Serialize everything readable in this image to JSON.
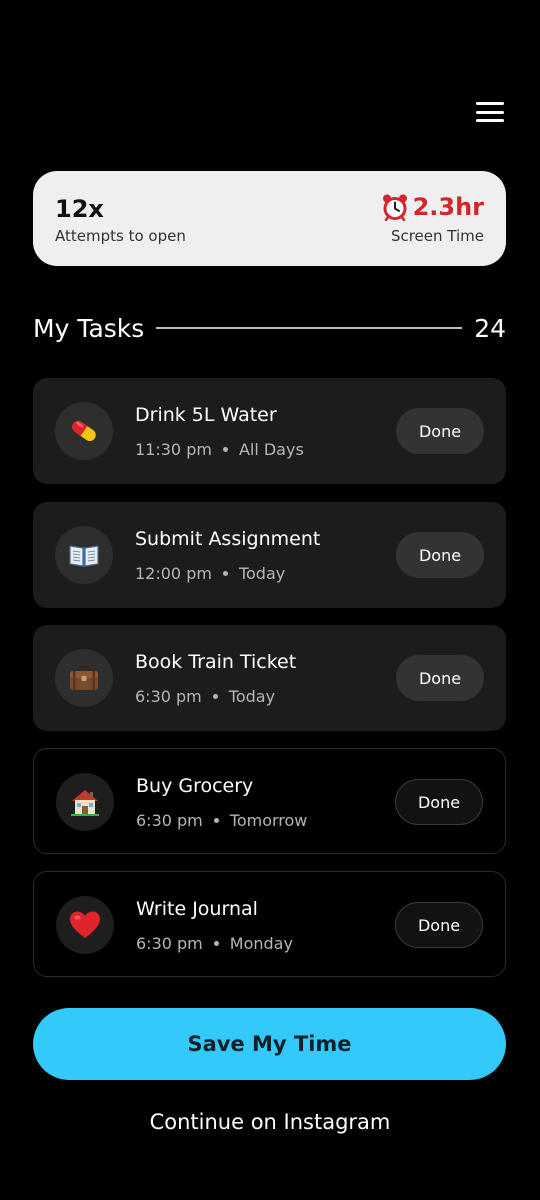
{
  "header": {
    "menu_icon": "hamburger-menu-icon"
  },
  "stats": {
    "attempts_value": "12x",
    "attempts_label": "Attempts to open",
    "screen_time_value": "2.3hr",
    "screen_time_label": "Screen Time",
    "screen_time_icon": "alarm-clock-icon",
    "screen_time_color": "#d3262c"
  },
  "tasks_section": {
    "title": "My Tasks",
    "count": "24"
  },
  "tasks": [
    {
      "title": "Drink 5L Water",
      "time": "11:30 pm",
      "when": "All Days",
      "icon": "pill-icon",
      "done_label": "Done"
    },
    {
      "title": "Submit Assignment",
      "time": "12:00 pm",
      "when": "Today",
      "icon": "open-book-icon",
      "done_label": "Done"
    },
    {
      "title": "Book Train Ticket",
      "time": "6:30 pm",
      "when": "Today",
      "icon": "briefcase-icon",
      "done_label": "Done"
    },
    {
      "title": "Buy Grocery",
      "time": "6:30 pm",
      "when": "Tomorrow",
      "icon": "house-icon",
      "done_label": "Done"
    },
    {
      "title": "Write Journal",
      "time": "6:30 pm",
      "when": "Monday",
      "icon": "heart-icon",
      "done_label": "Done"
    }
  ],
  "actions": {
    "save_label": "Save My Time",
    "continue_label": "Continue on Instagram"
  },
  "colors": {
    "background": "#000000",
    "accent": "#33c9fb",
    "card_light": "#efefef",
    "task_card": "#1c1c1c"
  }
}
